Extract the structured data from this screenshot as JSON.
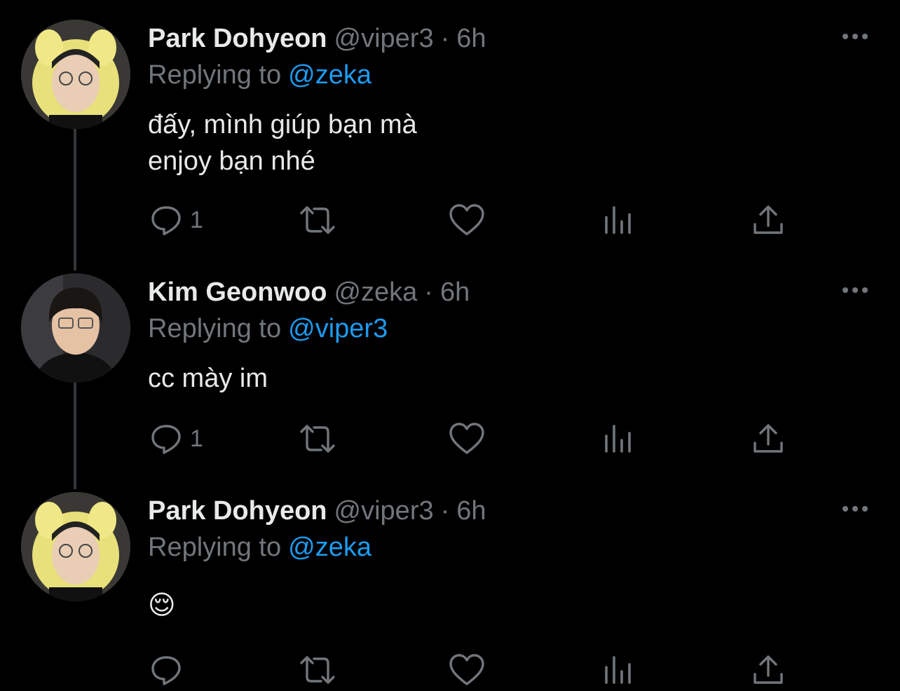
{
  "tweets": [
    {
      "name": "Park Dohyeon",
      "handle": "@viper3",
      "time": "6h",
      "reply_prefix": "Replying to",
      "reply_to": "@zeka",
      "lines": [
        "đấy, mình giúp bạn mà",
        "enjoy bạn nhé"
      ],
      "reply_count": "1",
      "avatar_icon": "avatar-yellow-hood"
    },
    {
      "name": "Kim Geonwoo",
      "handle": "@zeka",
      "time": "6h",
      "reply_prefix": "Replying to",
      "reply_to": "@viper3",
      "lines": [
        "cc mày im"
      ],
      "reply_count": "1",
      "avatar_icon": "avatar-dark-hair"
    },
    {
      "name": "Park Dohyeon",
      "handle": "@viper3",
      "time": "6h",
      "reply_prefix": "Replying to",
      "reply_to": "@zeka",
      "lines": [
        "😌"
      ],
      "reply_count": "",
      "avatar_icon": "avatar-yellow-hood"
    }
  ],
  "meta_separator": "·",
  "colors": {
    "background": "#000000",
    "text": "#e7e9ea",
    "secondary": "#71767b",
    "mention": "#1d9bf0",
    "thread_line": "#333639"
  }
}
